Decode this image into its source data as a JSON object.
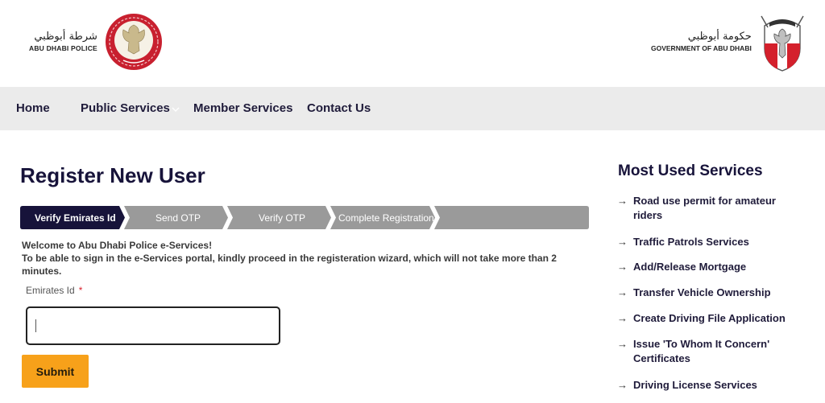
{
  "header": {
    "left_logo": {
      "arabic_text": "شرطة أبوظبي",
      "latin_text": "ABU DHABI POLICE",
      "emblem": "abu-dhabi-police-emblem",
      "emblem_color": "#c8202f"
    },
    "right_logo": {
      "arabic_text": "حكومة أبوظبي",
      "latin_text": "GOVERNMENT OF ABU DHABI",
      "emblem": "abu-dhabi-government-emblem",
      "emblem_color": "#d4202c"
    }
  },
  "nav": {
    "items": [
      {
        "label": "Home"
      },
      {
        "label": "Public Services",
        "has_dropdown": true
      },
      {
        "label": "Member Services"
      },
      {
        "label": "Contact Us"
      }
    ]
  },
  "page": {
    "title": "Register New User"
  },
  "wizard": {
    "steps": [
      {
        "label": "Verify Emirates Id",
        "active": true
      },
      {
        "label": "Send OTP",
        "active": false
      },
      {
        "label": "Verify OTP",
        "active": false
      },
      {
        "label": "Complete Registration",
        "active": false
      }
    ],
    "active_color": "#17133a",
    "inactive_color": "#9a9a9a"
  },
  "intro": {
    "line1": "Welcome to Abu Dhabi Police e-Services!",
    "line2": "To be able to sign in the e-Services portal, kindly proceed in the registeration wizard, which will not take more than 2 minutes."
  },
  "form": {
    "emirates_id_label": "Emirates Id",
    "required_marker": "*",
    "emirates_id_value": "",
    "submit_label": "Submit",
    "submit_color": "#f7a11a"
  },
  "sidebar": {
    "title": "Most Used Services",
    "arrow_icon": "→",
    "items": [
      {
        "label": "Road use permit for amateur riders"
      },
      {
        "label": "Traffic Patrols Services"
      },
      {
        "label": "Add/Release Mortgage"
      },
      {
        "label": "Transfer Vehicle Ownership"
      },
      {
        "label": "Create Driving File Application"
      },
      {
        "label": "Issue 'To Whom It Concern' Certificates"
      },
      {
        "label": "Driving License Services"
      }
    ]
  }
}
